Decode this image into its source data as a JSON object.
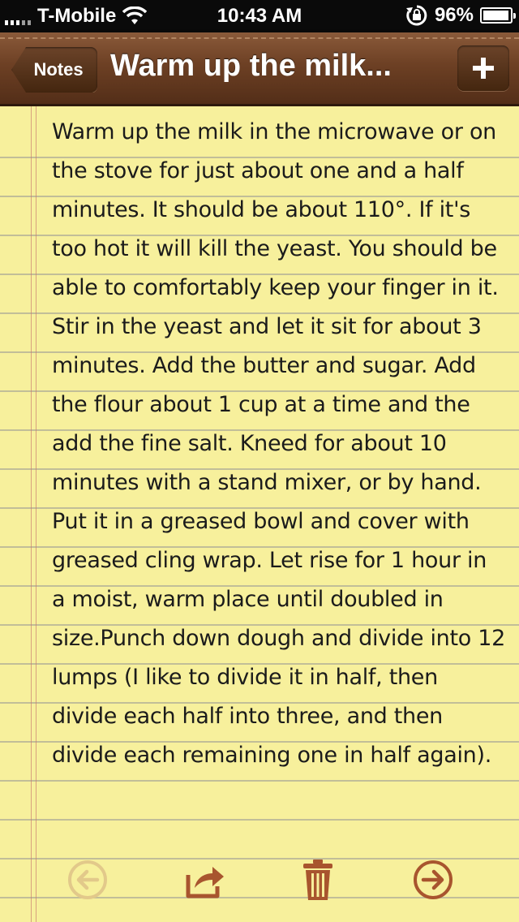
{
  "status_bar": {
    "carrier": "T-Mobile",
    "time": "10:43 AM",
    "battery": "96%",
    "battery_level": 0.96
  },
  "nav_bar": {
    "back_label": "Notes",
    "title": "Warm up the milk..."
  },
  "note": {
    "text": "Warm up the milk in the microwave or on the stove for just about one and a half minutes. It should be about 110°. If it's too hot it will kill the yeast. You should be able to comfortably keep your finger in it. Stir in the yeast and let it sit for about 3 minutes. Add the butter and sugar. Add the flour about 1 cup at a time and the add the fine salt. Kneed for about 10 minutes with a stand mixer, or by hand. Put it in a greased bowl and cover with greased cling wrap. Let rise for 1 hour in a moist, warm place until doubled in size.Punch down dough and divide into 12 lumps (I like to divide it in half, then divide each half into three, and then divide each remaining one in half again)."
  },
  "colors": {
    "leather": "#6d4024",
    "paper": "#f7f09c",
    "icon_brown": "#a8552e",
    "icon_disabled": "#e2c98a"
  },
  "toolbar": {
    "icons": [
      "previous-note-icon",
      "share-icon",
      "trash-icon",
      "next-note-icon"
    ]
  }
}
